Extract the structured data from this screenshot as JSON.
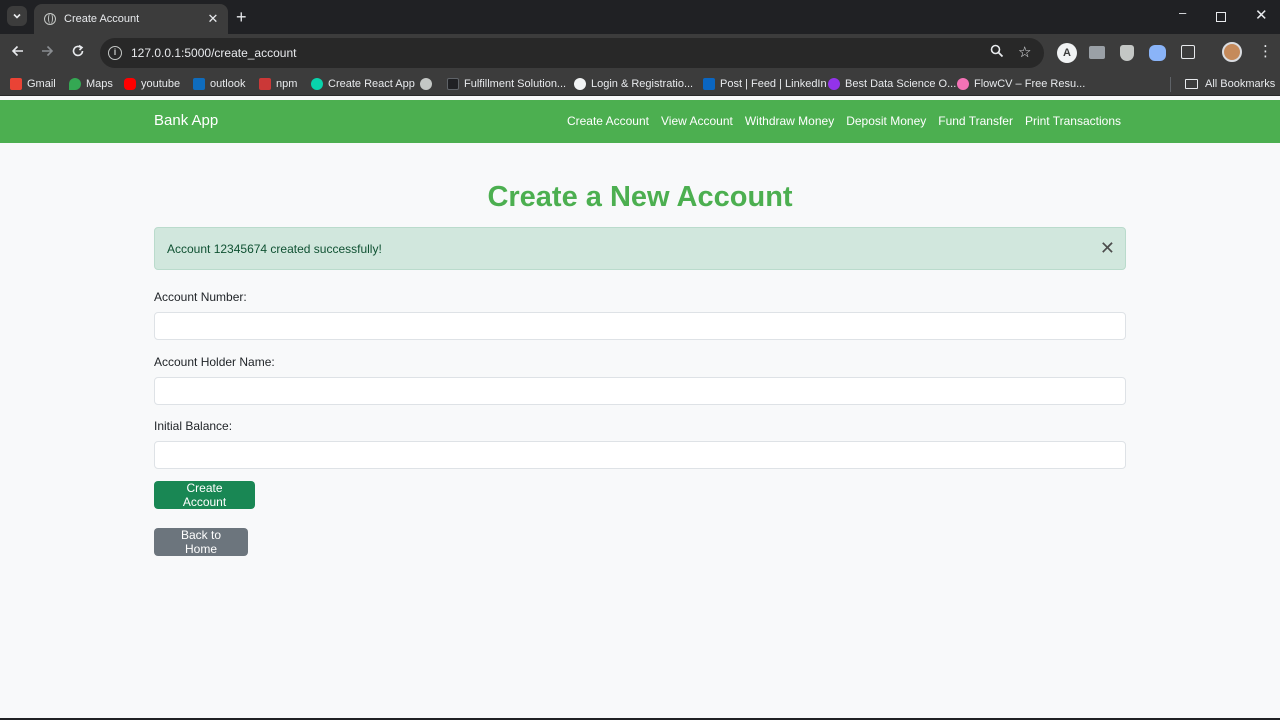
{
  "browser": {
    "tab_title": "Create Account",
    "url": "127.0.0.1:5000/create_account",
    "bookmarks": [
      {
        "label": "Gmail",
        "icon": "gmail-icon",
        "color": "#ea4335"
      },
      {
        "label": "Maps",
        "icon": "maps-icon",
        "color": "#34a853"
      },
      {
        "label": "youtube",
        "icon": "youtube-icon",
        "color": "#ff0000"
      },
      {
        "label": "outlook",
        "icon": "outlook-icon",
        "color": "#0f6cbd"
      },
      {
        "label": "npm",
        "icon": "npm-icon",
        "color": "#cb3837"
      },
      {
        "label": "Create React App",
        "icon": "react-icon",
        "color": "#09d3ac"
      },
      {
        "label": "",
        "icon": "globe-icon",
        "color": "#c4c7c5"
      },
      {
        "label": "Fulfillment Solution...",
        "icon": "fulfillment-icon",
        "color": "#202124"
      },
      {
        "label": "Login & Registratio...",
        "icon": "github-icon",
        "color": "#f1f3f4"
      },
      {
        "label": "Post | Feed | LinkedIn",
        "icon": "linkedin-icon",
        "color": "#0a66c2"
      },
      {
        "label": "Best Data Science O...",
        "icon": "datascience-icon",
        "color": "#9333ea"
      },
      {
        "label": "FlowCV – Free Resu...",
        "icon": "flowcv-icon",
        "color": "#f472b6"
      }
    ],
    "all_bookmarks": "All Bookmarks"
  },
  "navbar": {
    "brand": "Bank App",
    "links": [
      "Create Account",
      "View Account",
      "Withdraw Money",
      "Deposit Money",
      "Fund Transfer",
      "Print Transactions"
    ]
  },
  "page": {
    "heading": "Create a New Account",
    "alert": {
      "message": "Account 12345674 created successfully!",
      "close": "✕"
    },
    "form": {
      "account_number_label": "Account Number:",
      "account_number_value": "",
      "holder_name_label": "Account Holder Name:",
      "holder_name_value": "",
      "initial_balance_label": "Initial Balance:",
      "initial_balance_value": "",
      "submit_label": "Create Account"
    },
    "back_label": "Back to Home"
  },
  "colors": {
    "brand_green": "#4caf50",
    "alert_bg": "#d1e7dd",
    "alert_text": "#0f5132",
    "primary_button": "#198754",
    "secondary_button": "#6c757d"
  }
}
